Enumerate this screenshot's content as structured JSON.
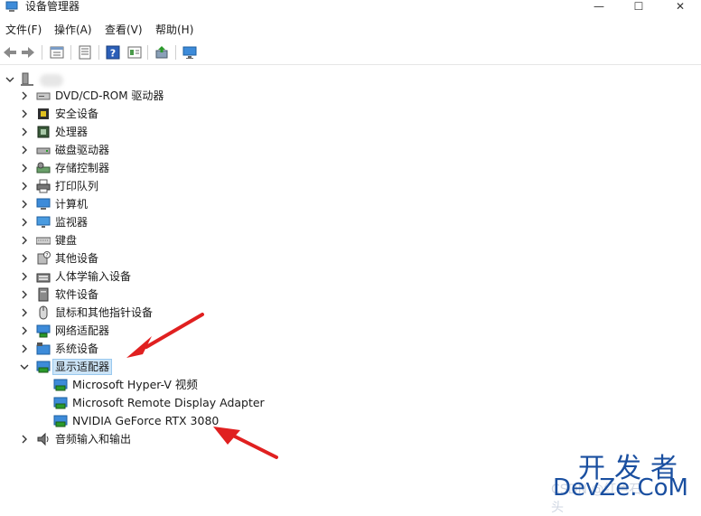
{
  "window": {
    "title": "设备管理器",
    "minimize_glyph": "—",
    "maximize_glyph": "☐",
    "close_glyph": "✕"
  },
  "menu": {
    "items": [
      {
        "label": "文件(F)"
      },
      {
        "label": "操作(A)"
      },
      {
        "label": "查看(V)"
      },
      {
        "label": "帮助(H)"
      }
    ]
  },
  "toolbar": {
    "buttons": [
      {
        "icon": "back-arrow-icon"
      },
      {
        "icon": "forward-arrow-icon"
      },
      {
        "icon": "properties-icon"
      },
      {
        "icon": "list-icon"
      },
      {
        "icon": "help-icon",
        "glyph": "?"
      },
      {
        "icon": "details-icon"
      },
      {
        "icon": "update-driver-icon"
      },
      {
        "icon": "monitor-icon"
      }
    ]
  },
  "tree": {
    "root": {
      "icon": "computer-root-icon"
    },
    "categories": [
      {
        "label": "DVD/CD-ROM 驱动器",
        "icon": "dvd-drive-icon"
      },
      {
        "label": "安全设备",
        "icon": "security-device-icon"
      },
      {
        "label": "处理器",
        "icon": "processor-icon"
      },
      {
        "label": "磁盘驱动器",
        "icon": "disk-drive-icon"
      },
      {
        "label": "存储控制器",
        "icon": "storage-controller-icon"
      },
      {
        "label": "打印队列",
        "icon": "printer-icon"
      },
      {
        "label": "计算机",
        "icon": "computer-icon"
      },
      {
        "label": "监视器",
        "icon": "monitor-icon"
      },
      {
        "label": "键盘",
        "icon": "keyboard-icon"
      },
      {
        "label": "其他设备",
        "icon": "other-device-icon"
      },
      {
        "label": "人体学输入设备",
        "icon": "hid-icon"
      },
      {
        "label": "软件设备",
        "icon": "software-device-icon"
      },
      {
        "label": "鼠标和其他指针设备",
        "icon": "mouse-icon"
      },
      {
        "label": "网络适配器",
        "icon": "network-adapter-icon"
      },
      {
        "label": "系统设备",
        "icon": "system-device-icon"
      },
      {
        "label": "显示适配器",
        "icon": "display-adapter-icon",
        "expanded": true,
        "selected": true
      }
    ],
    "display_adapters": [
      {
        "label": "Microsoft Hyper-V 视频",
        "icon": "display-adapter-icon"
      },
      {
        "label": "Microsoft Remote Display Adapter",
        "icon": "display-adapter-icon"
      },
      {
        "label": "NVIDIA GeForce RTX 3080",
        "icon": "display-adapter-icon"
      }
    ],
    "last_category": {
      "label": "音频输入和输出",
      "icon": "speaker-icon"
    }
  },
  "annotations": {
    "arrow_color": "#e02020"
  },
  "watermark": {
    "line1": "开发者",
    "line2": "DevZe.CoM",
    "faint": "CSDN @红色石头"
  },
  "colors": {
    "selection_bg": "#cce4f7",
    "selection_border": "#99c9ef",
    "watermark": "#1a4fa0"
  }
}
